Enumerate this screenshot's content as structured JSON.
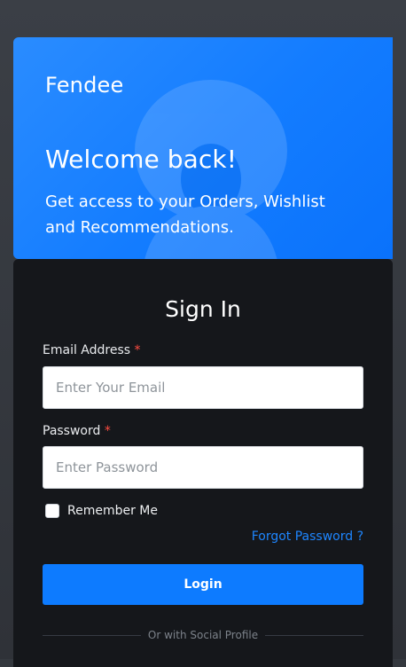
{
  "hero": {
    "brand": "Fendee",
    "title": "Welcome back!",
    "subtitle": "Get access to your Orders, Wishlist and Recommendations."
  },
  "signin": {
    "title": "Sign In",
    "email": {
      "label": "Email Address",
      "required_mark": "*",
      "placeholder": "Enter Your Email",
      "value": ""
    },
    "password": {
      "label": "Password",
      "required_mark": "*",
      "placeholder": "Enter Password",
      "value": ""
    },
    "remember_label": "Remember Me",
    "remember_checked": false,
    "forgot_label": "Forgot Password ?",
    "login_label": "Login",
    "social_divider": "Or with Social Profile"
  },
  "colors": {
    "accent": "#0d7bff",
    "hero_bg": "#137cff",
    "panel_bg": "#15171b",
    "required": "#ff4c41"
  }
}
